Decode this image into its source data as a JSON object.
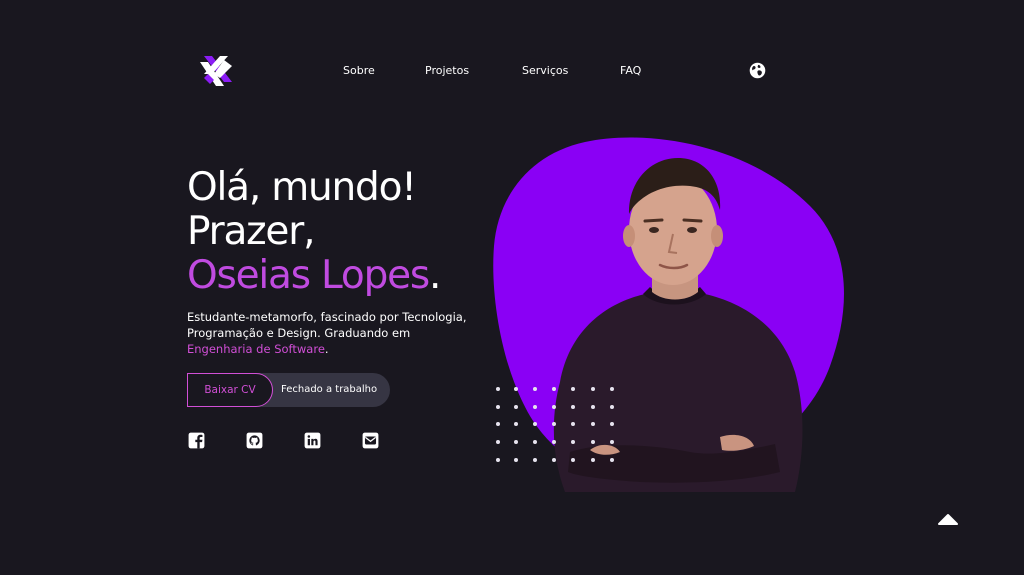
{
  "nav": {
    "items": [
      {
        "label": "Sobre"
      },
      {
        "label": "Projetos"
      },
      {
        "label": "Serviços"
      },
      {
        "label": "FAQ"
      }
    ],
    "language_icon": "globe-icon"
  },
  "hero": {
    "greeting_line1": "Olá, mundo!",
    "greeting_line2": "Prazer,",
    "name": "Oseias Lopes",
    "name_period": ".",
    "description_main": "Estudante-metamorfo, fascinado por Tecnologia, Programação e Design. Graduando em",
    "description_highlight": "Engenharia de Software",
    "description_end": ".",
    "cv_button": "Baixar CV",
    "status": "Fechado a trabalho"
  },
  "social": {
    "icons": [
      "facebook-icon",
      "github-icon",
      "linkedin-icon",
      "email-icon"
    ]
  },
  "colors": {
    "background": "#19171f",
    "accent": "#d14fd6",
    "blob": "#8a00f5",
    "pill": "#363543"
  }
}
